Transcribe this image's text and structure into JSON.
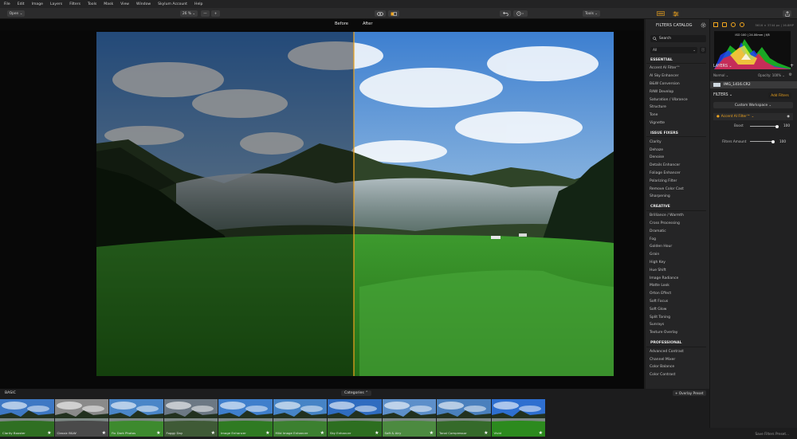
{
  "menu": [
    "File",
    "Edit",
    "Image",
    "Layers",
    "Filters",
    "Tools",
    "Mask",
    "View",
    "Window",
    "Skylum Account",
    "Help"
  ],
  "toolbar": {
    "open": "Open ⌄",
    "zoom": "26 % ⌄",
    "minus": "—",
    "plus": "+",
    "tools": "Tools ⌄"
  },
  "compare": {
    "before": "Before",
    "after": "After"
  },
  "catalog": {
    "title": "FILTERS CATALOG",
    "search_placeholder": "Search",
    "scope": "All",
    "groups": [
      {
        "title": "ESSENTIAL",
        "items": [
          "Accent AI Filter™",
          "AI Sky Enhancer",
          "B&W Conversion",
          "RAW Develop",
          "Saturation / Vibrance",
          "Structure",
          "Tone",
          "Vignette"
        ]
      },
      {
        "title": "ISSUE FIXERS",
        "items": [
          "Clarity",
          "Dehaze",
          "Denoise",
          "Details Enhancer",
          "Foliage Enhancer",
          "Polarizing Filter",
          "Remove Color Cast",
          "Sharpening"
        ]
      },
      {
        "title": "CREATIVE",
        "items": [
          "Brilliance / Warmth",
          "Cross Processing",
          "Dramatic",
          "Fog",
          "Golden Hour",
          "Grain",
          "High Key",
          "Hue Shift",
          "Image Radiance",
          "Matte Look",
          "Orton Effect",
          "Soft Focus",
          "Soft Glow",
          "Split Toning",
          "Sunrays",
          "Texture Overlay"
        ]
      },
      {
        "title": "PROFESSIONAL",
        "items": [
          "Advanced Contrast",
          "Channel Mixer",
          "Color Balance",
          "Color Contrast"
        ]
      }
    ]
  },
  "right": {
    "info": "5616 × 3744 px  |  16.8MP",
    "exif": "ISO 100  |  24.00mm  |  f/8",
    "layers_title": "LAYERS ⌄",
    "blend": "Normal ⌄",
    "opacity": "Opacity: 100% ⌄",
    "layer_name": "IMG_1416.CR2",
    "filters_title": "FILTERS ⌄",
    "add_filters": "Add Filters",
    "workspace": "Custom Workspace ⌄",
    "filter_name": "Accent AI Filter™ ⌄",
    "boost_label": "Boost",
    "boost_value": "100",
    "amount_label": "Filters Amount",
    "amount_value": "100",
    "save_preset": "Save Filters Preset..."
  },
  "strip": {
    "section": "BASIC",
    "categories": "Categories ⌃",
    "overlay": "+ Overlay Preset",
    "thumbs": [
      "Clarity Booster",
      "Classic B&W",
      "Fix Dark Photos",
      "Foggy Day",
      "Image Enhancer",
      "Mild Image Enhancer",
      "Sky Enhancer",
      "Soft & Airy",
      "Tonal Compressor",
      "Vivid"
    ]
  },
  "colors": {
    "accent": "#f0a51e",
    "panel": "#252526",
    "background": "#080808"
  }
}
